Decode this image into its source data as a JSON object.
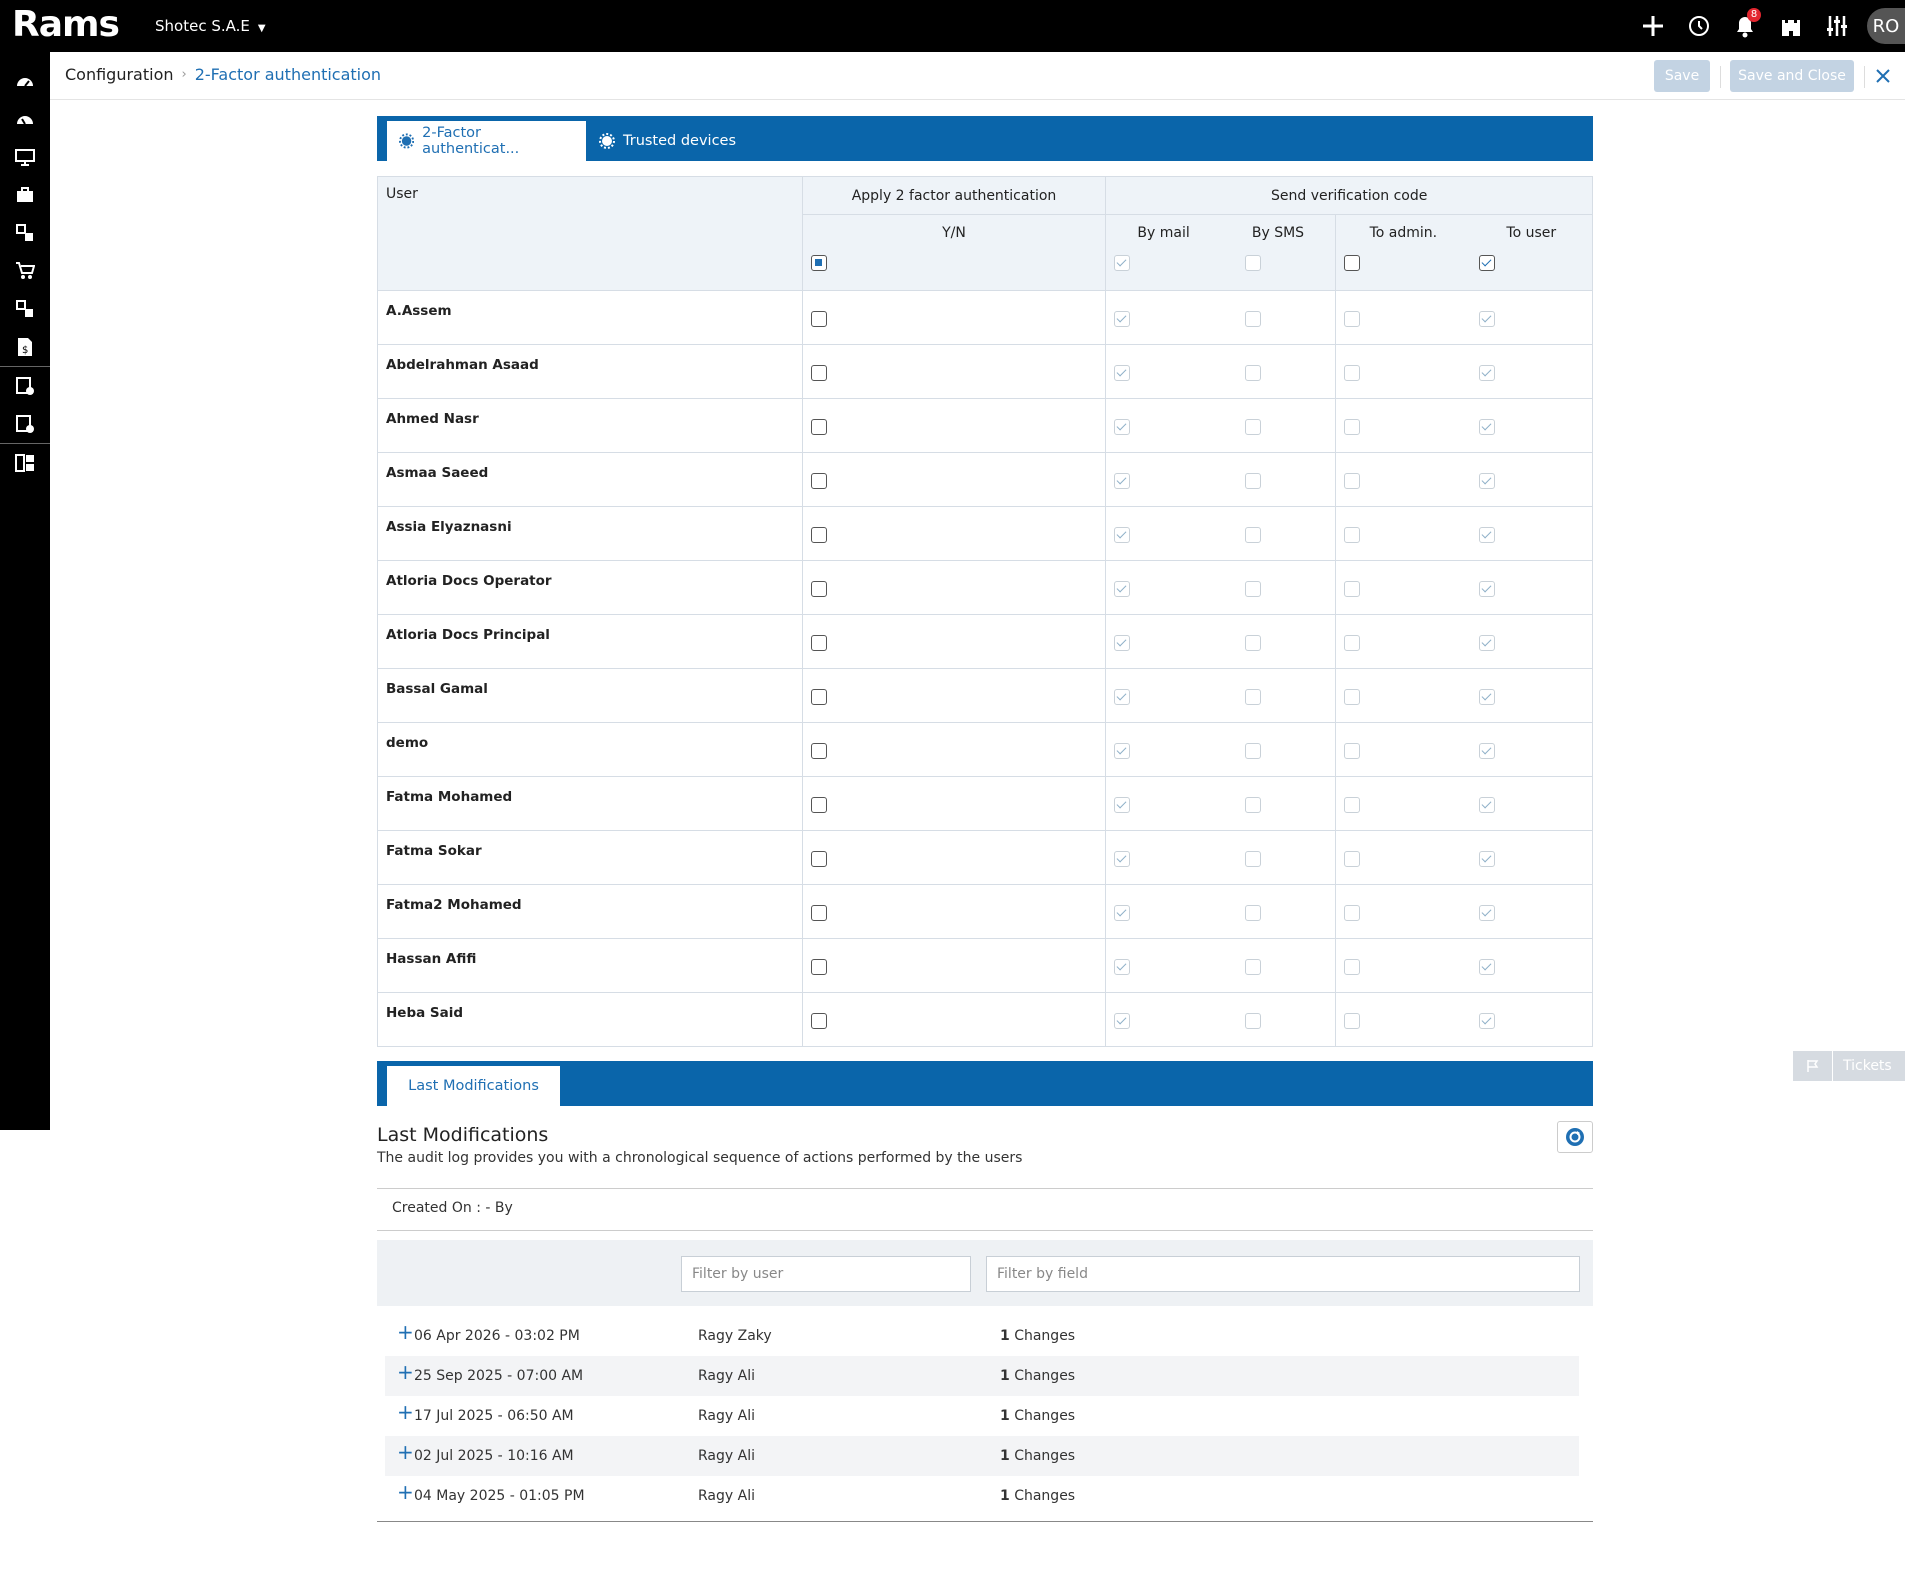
{
  "app": {
    "logo": "Rams",
    "company": "Shotec S.A.E",
    "notifications": "8",
    "user_initials": "RO"
  },
  "breadcrumb": {
    "parent": "Configuration",
    "current": "2-Factor authentication"
  },
  "header_buttons": {
    "save": "Save",
    "save_close": "Save and Close"
  },
  "tabs": [
    {
      "label": "2-Factor authenticat..."
    },
    {
      "label": "Trusted devices"
    }
  ],
  "grid": {
    "col_user": "User",
    "col_apply": "Apply 2 factor authentication",
    "col_send": "Send verification code",
    "sub_yn": "Y/N",
    "sub_mail": "By mail",
    "sub_sms": "By SMS",
    "sub_admin": "To admin.",
    "sub_user": "To user",
    "users": [
      "A.Assem",
      "Abdelrahman Asaad",
      "Ahmed Nasr",
      "Asmaa Saeed",
      "Assia Elyaznasni",
      "Atloria Docs Operator",
      "Atloria Docs Principal",
      "Bassal Gamal",
      "demo",
      "Fatma Mohamed",
      "Fatma Sokar",
      "Fatma2 Mohamed",
      "Hassan Afifi",
      "Heba Said"
    ]
  },
  "last_mod": {
    "tab": "Last Modifications",
    "title": "Last Modifications",
    "desc": "The audit log provides you with a chronological sequence of actions performed by the users",
    "created": "Created On : - By",
    "filter_user": "Filter by user",
    "filter_field": "Filter by field",
    "rows": [
      {
        "date": "06 Apr 2026 - 03:02 PM",
        "user": "Ragy Zaky",
        "count": "1",
        "label": "Changes"
      },
      {
        "date": "25 Sep 2025 - 07:00 AM",
        "user": "Ragy Ali",
        "count": "1",
        "label": "Changes"
      },
      {
        "date": "17 Jul 2025 - 06:50 AM",
        "user": "Ragy Ali",
        "count": "1",
        "label": "Changes"
      },
      {
        "date": "02 Jul 2025 - 10:16 AM",
        "user": "Ragy Ali",
        "count": "1",
        "label": "Changes"
      },
      {
        "date": "04 May 2025 - 01:05 PM",
        "user": "Ragy Ali",
        "count": "1",
        "label": "Changes"
      }
    ]
  },
  "tickets": "Tickets",
  "colors": {
    "primary": "#0a65aa",
    "link": "#1f6fb3",
    "badge": "#e3262f"
  }
}
